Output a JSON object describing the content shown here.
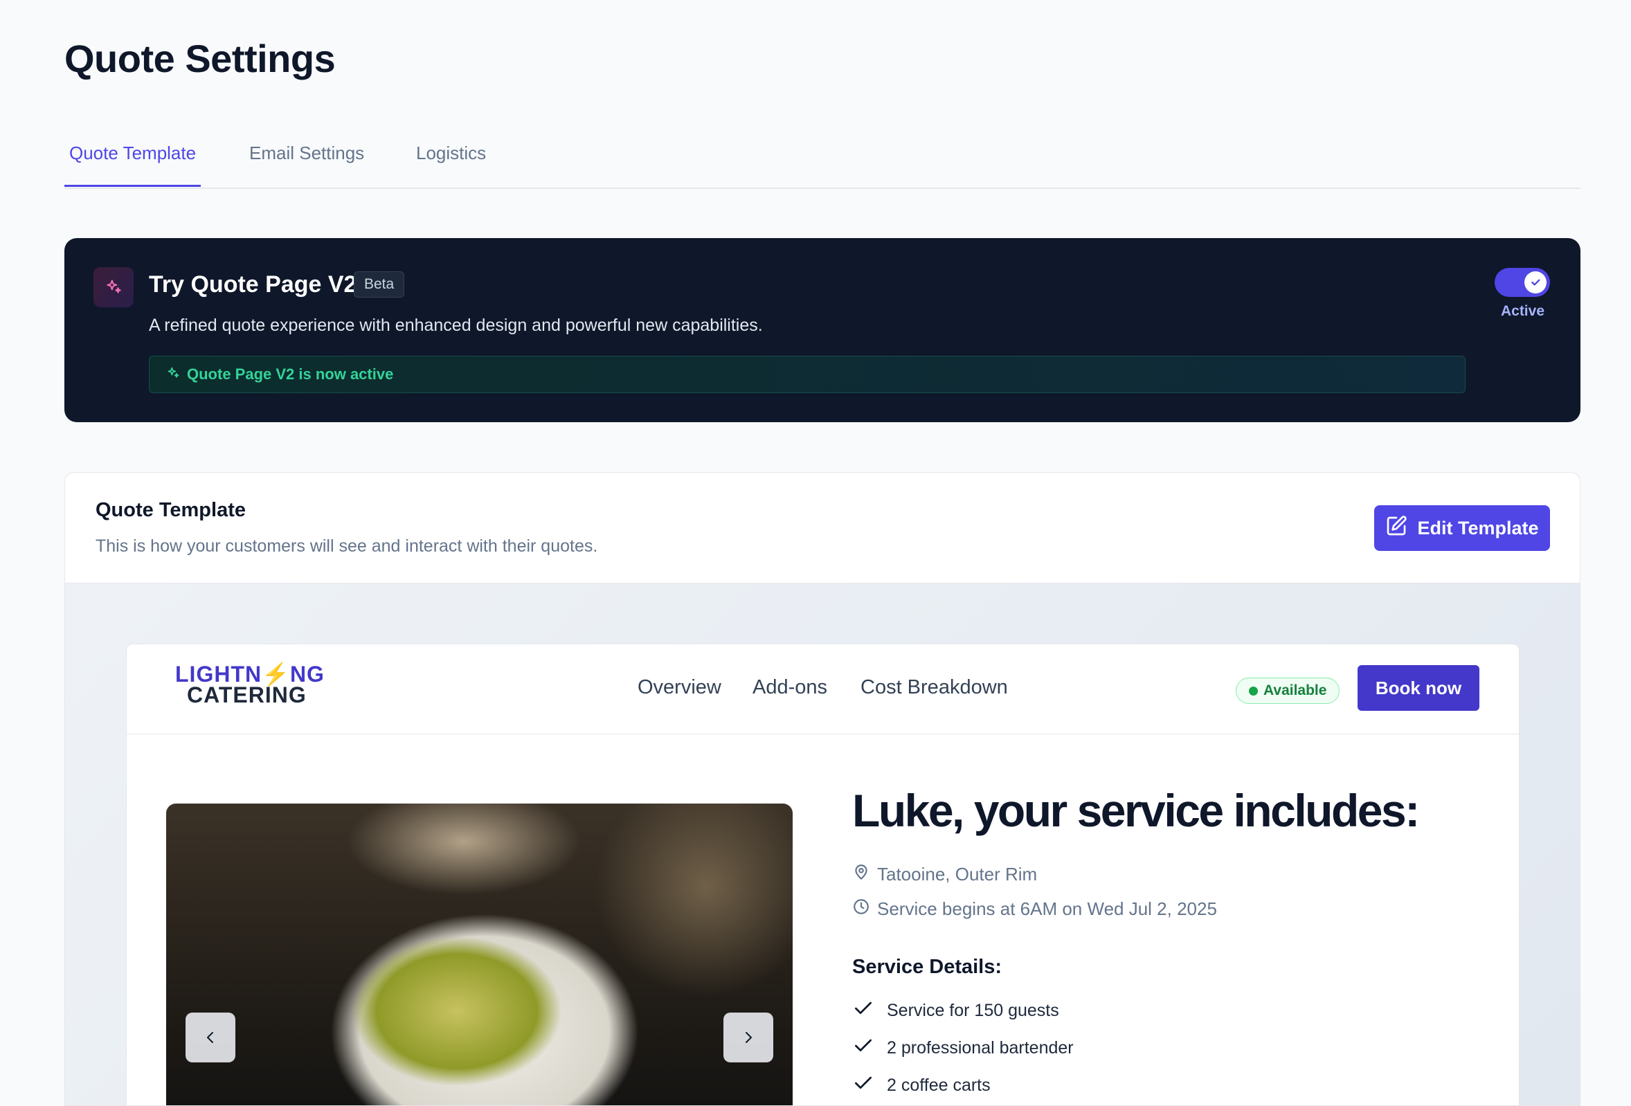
{
  "page": {
    "title": "Quote Settings"
  },
  "tabs": [
    {
      "label": "Quote Template"
    },
    {
      "label": "Email Settings"
    },
    {
      "label": "Logistics"
    }
  ],
  "banner": {
    "title": "Try Quote Page V2",
    "badge": "Beta",
    "description": "A refined quote experience with enhanced design and powerful new capabilities.",
    "status": "Quote Page V2 is now active",
    "toggle_label": "Active",
    "toggle_on": true
  },
  "template_card": {
    "title": "Quote Template",
    "description": "This is how your customers will see and interact with their quotes.",
    "edit_button": "Edit Template"
  },
  "preview": {
    "logo_line1": "LIGHTN⚡NG",
    "logo_line2": "CATERING",
    "nav": [
      "Overview",
      "Add-ons",
      "Cost Breakdown"
    ],
    "availability": "Available",
    "book_button": "Book now",
    "headline": "Luke, your service includes:",
    "location": "Tatooine, Outer Rim",
    "service_time": "Service begins at 6AM on Wed Jul 2, 2025",
    "details_title": "Service Details:",
    "details": [
      "Service for 150 guests",
      "2 professional bartender",
      "2 coffee carts"
    ]
  },
  "colors": {
    "accent": "#4f46e5",
    "banner_bg": "#0f172a",
    "success": "#16a34a"
  }
}
